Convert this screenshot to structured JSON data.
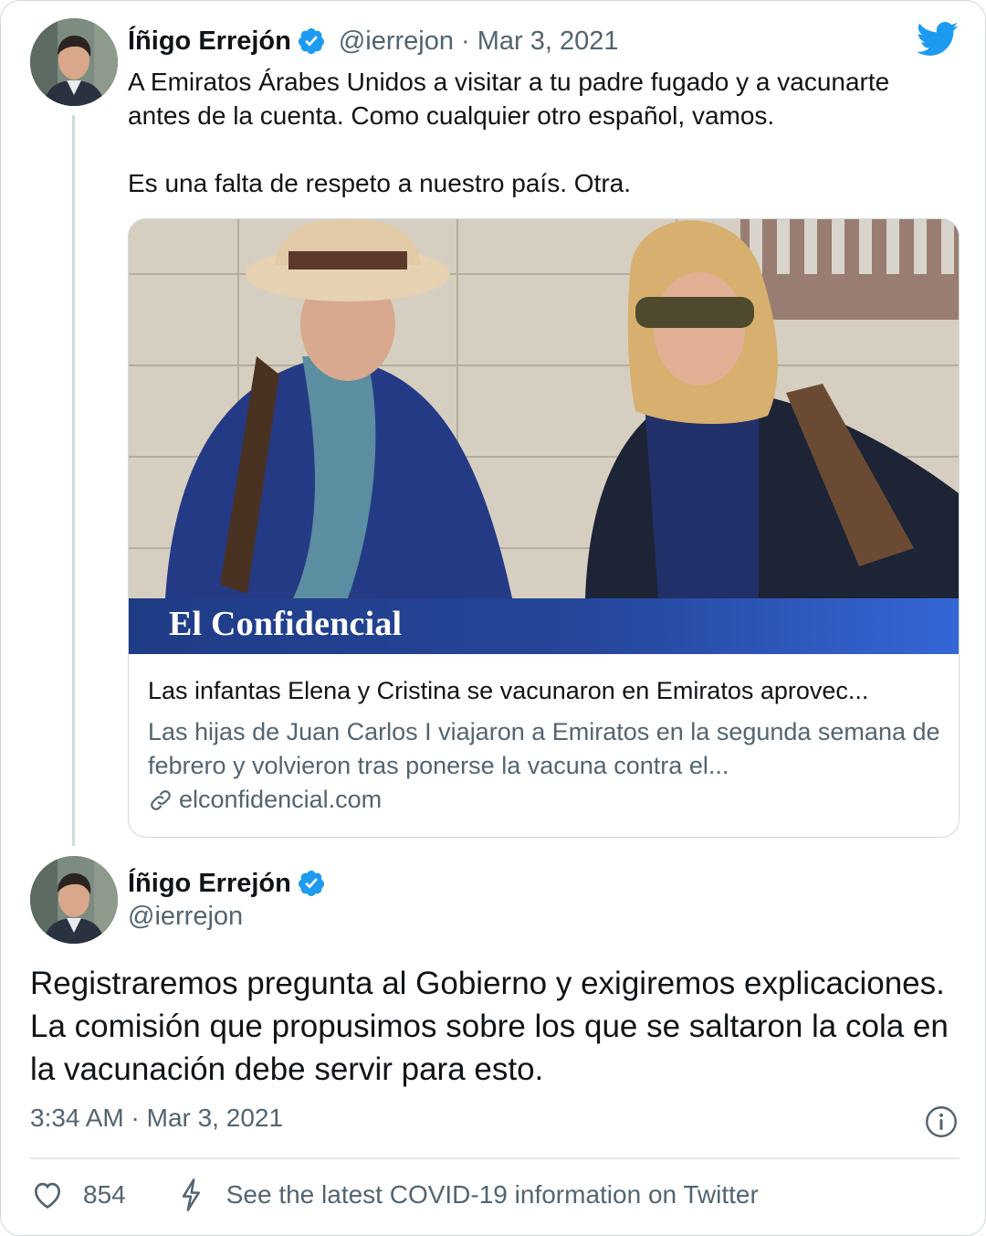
{
  "colors": {
    "accent": "#1d9bf0",
    "text": "#0f1419",
    "muted": "#536471",
    "brand_band": "#25469a"
  },
  "quoted_tweet": {
    "author_name": "Íñigo Errejón",
    "handle_date": "@ierrejon · Mar 3, 2021",
    "text": "A Emiratos Árabes Unidos a visitar a tu padre fugado y a vacunarte antes de la cuenta. Como cualquier otro español, vamos.\n\nEs una falta de respeto a nuestro país. Otra.",
    "link_card": {
      "brand": "El Confidencial",
      "title": "Las infantas Elena y Cristina se vacunaron en Emiratos aprovec...",
      "description": "Las hijas de Juan Carlos I viajaron a Emiratos en la segunda semana de febrero y volvieron tras ponerse la vacuna contra el...",
      "domain": "elconfidencial.com"
    }
  },
  "main_tweet": {
    "author_name": "Íñigo Errejón",
    "handle": "@ierrejon",
    "text": "Registraremos pregunta al Gobierno y exigiremos explicaciones. La comisión que propusimos sobre los que se saltaron la cola en la vacunación debe servir para esto.",
    "timestamp": "3:34 AM · Mar 3, 2021",
    "like_count": "854",
    "covid_link": "See the latest COVID-19 information on Twitter"
  },
  "icons": [
    "twitter-bird-icon",
    "verified-badge-icon",
    "link-icon",
    "info-icon",
    "heart-icon",
    "lightning-icon"
  ]
}
